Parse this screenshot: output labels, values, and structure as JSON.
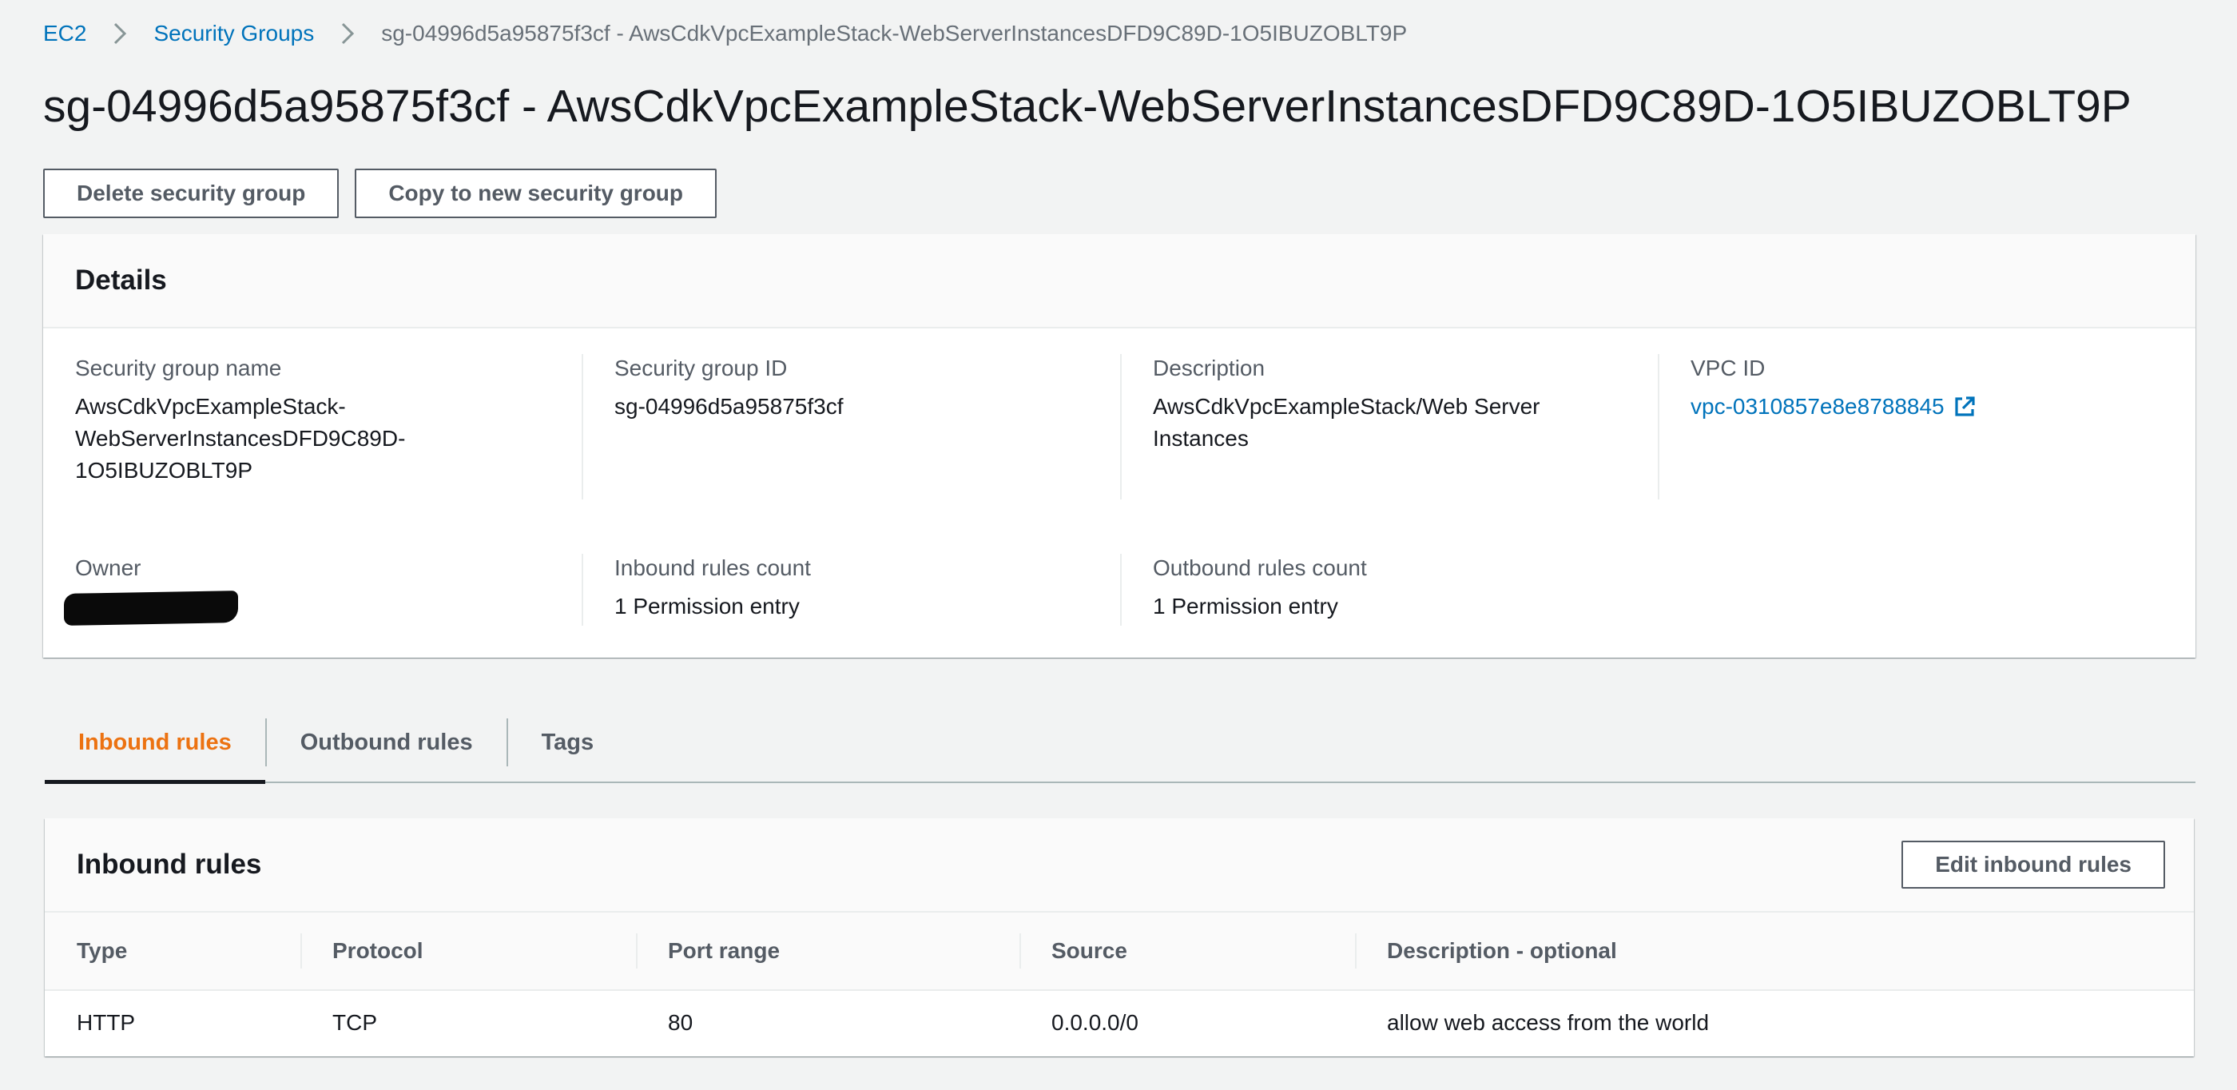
{
  "breadcrumb": {
    "items": [
      {
        "label": "EC2"
      },
      {
        "label": "Security Groups"
      }
    ],
    "current": "sg-04996d5a95875f3cf - AwsCdkVpcExampleStack-WebServerInstancesDFD9C89D-1O5IBUZOBLT9P"
  },
  "page": {
    "title": "sg-04996d5a95875f3cf - AwsCdkVpcExampleStack-WebServerInstancesDFD9C89D-1O5IBUZOBLT9P"
  },
  "actions": {
    "delete_label": "Delete security group",
    "copy_label": "Copy to new security group"
  },
  "details": {
    "heading": "Details",
    "sg_name_label": "Security group name",
    "sg_name_value_line1": "AwsCdkVpcExampleStack-",
    "sg_name_value_line2": "WebServerInstancesDFD9C89D-",
    "sg_name_value_line3": "1O5IBUZOBLT9P",
    "sg_id_label": "Security group ID",
    "sg_id_value": "sg-04996d5a95875f3cf",
    "description_label": "Description",
    "description_value_line1": "AwsCdkVpcExampleStack/Web Server",
    "description_value_line2": "Instances",
    "vpc_id_label": "VPC ID",
    "vpc_id_value": "vpc-0310857e8e8788845",
    "owner_label": "Owner",
    "inbound_count_label": "Inbound rules count",
    "inbound_count_value": "1 Permission entry",
    "outbound_count_label": "Outbound rules count",
    "outbound_count_value": "1 Permission entry"
  },
  "tabs": [
    {
      "label": "Inbound rules",
      "active": true
    },
    {
      "label": "Outbound rules",
      "active": false
    },
    {
      "label": "Tags",
      "active": false
    }
  ],
  "inbound_rules": {
    "heading": "Inbound rules",
    "edit_label": "Edit inbound rules",
    "columns": [
      "Type",
      "Protocol",
      "Port range",
      "Source",
      "Description - optional"
    ],
    "rows": [
      [
        "HTTP",
        "TCP",
        "80",
        "0.0.0.0/0",
        "allow web access from the world"
      ]
    ]
  },
  "colors": {
    "link": "#0073bb",
    "active_tab": "#ec7211",
    "text": "#16191f",
    "muted": "#545b64",
    "background": "#f2f3f3"
  },
  "icons": {
    "breadcrumb_separator": "chevron-right-icon",
    "vpc_link": "external-link-icon"
  }
}
